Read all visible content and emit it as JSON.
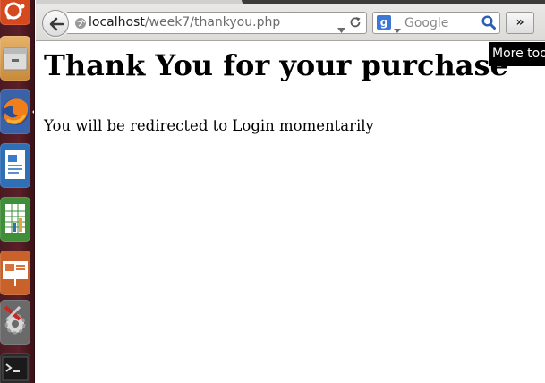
{
  "browser": {
    "url_host": "localhost",
    "url_path": "/week7/thankyou.php",
    "search_placeholder": "Google",
    "search_engine_letter": "g",
    "overflow_button_label": "»",
    "tooltip": "More tools"
  },
  "page": {
    "heading": "Thank You for your purchase",
    "message": "You will be redirected to Login momentarily"
  },
  "launcher": {
    "items": [
      "ubuntu-logo-icon",
      "file-manager-icon",
      "firefox-icon",
      "writer-icon",
      "calc-icon",
      "impress-icon",
      "system-settings-icon",
      "terminal-icon"
    ]
  },
  "colors": {
    "launcher_bg": "#5b2029",
    "chrome_bg": "#e2e1de",
    "tooltip_bg": "#000000",
    "google_blue": "#3d78d8"
  }
}
